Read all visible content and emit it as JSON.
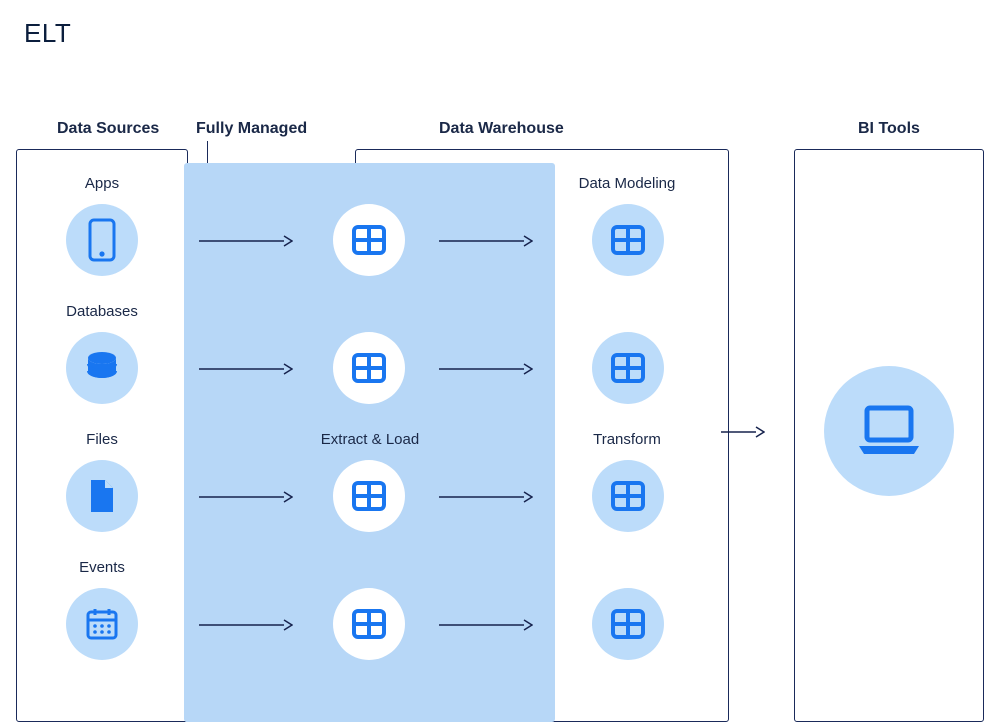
{
  "title": "ELT",
  "columns": {
    "sources": "Data Sources",
    "managed": "Fully Managed",
    "warehouse": "Data Warehouse",
    "bi": "BI Tools"
  },
  "sources": [
    {
      "label": "Apps",
      "icon": "phone-icon"
    },
    {
      "label": "Databases",
      "icon": "database-icon"
    },
    {
      "label": "Files",
      "icon": "file-icon"
    },
    {
      "label": "Events",
      "icon": "calendar-icon"
    }
  ],
  "stages": {
    "extract_load": "Extract & Load",
    "transform": "Transform",
    "modeling": "Data Modeling"
  },
  "colors": {
    "accent": "#0a6cff",
    "light": "#bcdcfa",
    "band": "#b7d7f7"
  }
}
